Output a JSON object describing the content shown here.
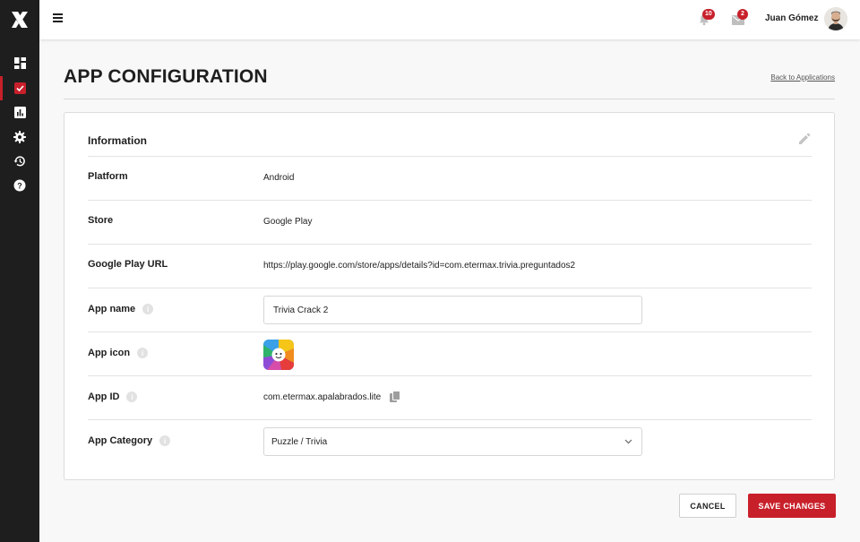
{
  "app": {
    "brand_color": "#c8202b",
    "sidebar_color": "#1e1e1e"
  },
  "sidebar": {
    "items": [
      {
        "icon": "dashboard-icon",
        "active": false
      },
      {
        "icon": "checkbox-icon",
        "active": true
      },
      {
        "icon": "bar-chart-icon",
        "active": false
      },
      {
        "icon": "gear-icon",
        "active": false
      },
      {
        "icon": "history-icon",
        "active": false
      },
      {
        "icon": "help-icon",
        "active": false
      }
    ]
  },
  "topbar": {
    "notifications_count": "10",
    "messages_count": "2",
    "user_name": "Juan Gómez"
  },
  "header": {
    "title": "APP CONFIGURATION",
    "back_link": "Back to Applications"
  },
  "card": {
    "title": "Information",
    "platform": {
      "label": "Platform",
      "value": "Android"
    },
    "store": {
      "label": "Store",
      "value": "Google Play"
    },
    "store_url": {
      "label": "Google Play URL",
      "value": "https://play.google.com/store/apps/details?id=com.etermax.trivia.preguntados2"
    },
    "app_name": {
      "label": "App name",
      "value": "Trivia Crack 2"
    },
    "app_icon": {
      "label": "App icon"
    },
    "app_id": {
      "label": "App ID",
      "value": "com.etermax.apalabrados.lite"
    },
    "app_category": {
      "label": "App Category",
      "value": "Puzzle / Trivia"
    }
  },
  "actions": {
    "cancel_label": "CANCEL",
    "save_label": "SAVE CHANGES"
  }
}
